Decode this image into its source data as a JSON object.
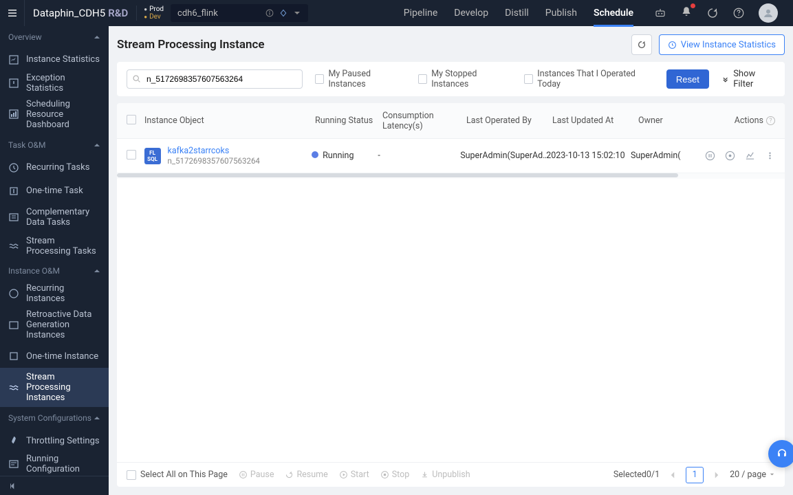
{
  "header": {
    "brand": "Dataphin_CDH5",
    "brand_suffix": "R&D",
    "env_prod": "Prod",
    "env_dev": "Dev",
    "project": "cdh6_flink"
  },
  "topnav": {
    "items": [
      "Pipeline",
      "Develop",
      "Distill",
      "Publish",
      "Schedule"
    ],
    "active": 4
  },
  "sidebar": {
    "groups": [
      {
        "label": "Overview",
        "items": [
          "Instance Statistics",
          "Exception Statistics",
          "Scheduling Resource Dashboard"
        ]
      },
      {
        "label": "Task O&M",
        "items": [
          "Recurring Tasks",
          "One-time Task",
          "Complementary Data Tasks",
          "Stream Processing Tasks"
        ]
      },
      {
        "label": "Instance O&M",
        "items": [
          "Recurring Instances",
          "Retroactive Data Generation Instances",
          "One-time Instance",
          "Stream Processing Instances"
        ]
      },
      {
        "label": "System Configurations",
        "items": [
          "Throttling Settings",
          "Running Configuration"
        ]
      }
    ]
  },
  "page": {
    "title": "Stream Processing Instance",
    "view_stats": "View Instance Statistics"
  },
  "filter": {
    "search_value": "n_5172698357607563264",
    "search_placeholder": "Search",
    "chk_paused": "My Paused Instances",
    "chk_stopped": "My Stopped Instances",
    "chk_today": "Instances That I Operated Today",
    "reset": "Reset",
    "show_filter": "Show Filter"
  },
  "table": {
    "cols": {
      "obj": "Instance Object",
      "status": "Running Status",
      "latency": "Consumption Latency(s)",
      "operated_by": "Last Operated By",
      "updated_at": "Last Updated At",
      "owner": "Owner",
      "actions": "Actions"
    },
    "rows": [
      {
        "badge_top": "FL",
        "badge_bot": "SQL",
        "name": "kafka2starrcoks",
        "id": "n_5172698357607563264",
        "status": "Running",
        "latency": "-",
        "operated_by": "SuperAdmin(SuperAd…",
        "updated_at": "2023-10-13 15:02:10",
        "owner": "SuperAdmin("
      }
    ]
  },
  "footer": {
    "select_all": "Select All on This Page",
    "actions": {
      "pause": "Pause",
      "resume": "Resume",
      "start": "Start",
      "stop": "Stop",
      "unpublish": "Unpublish"
    },
    "selected": "Selected0/1",
    "page": "1",
    "page_size": "20 / page"
  }
}
